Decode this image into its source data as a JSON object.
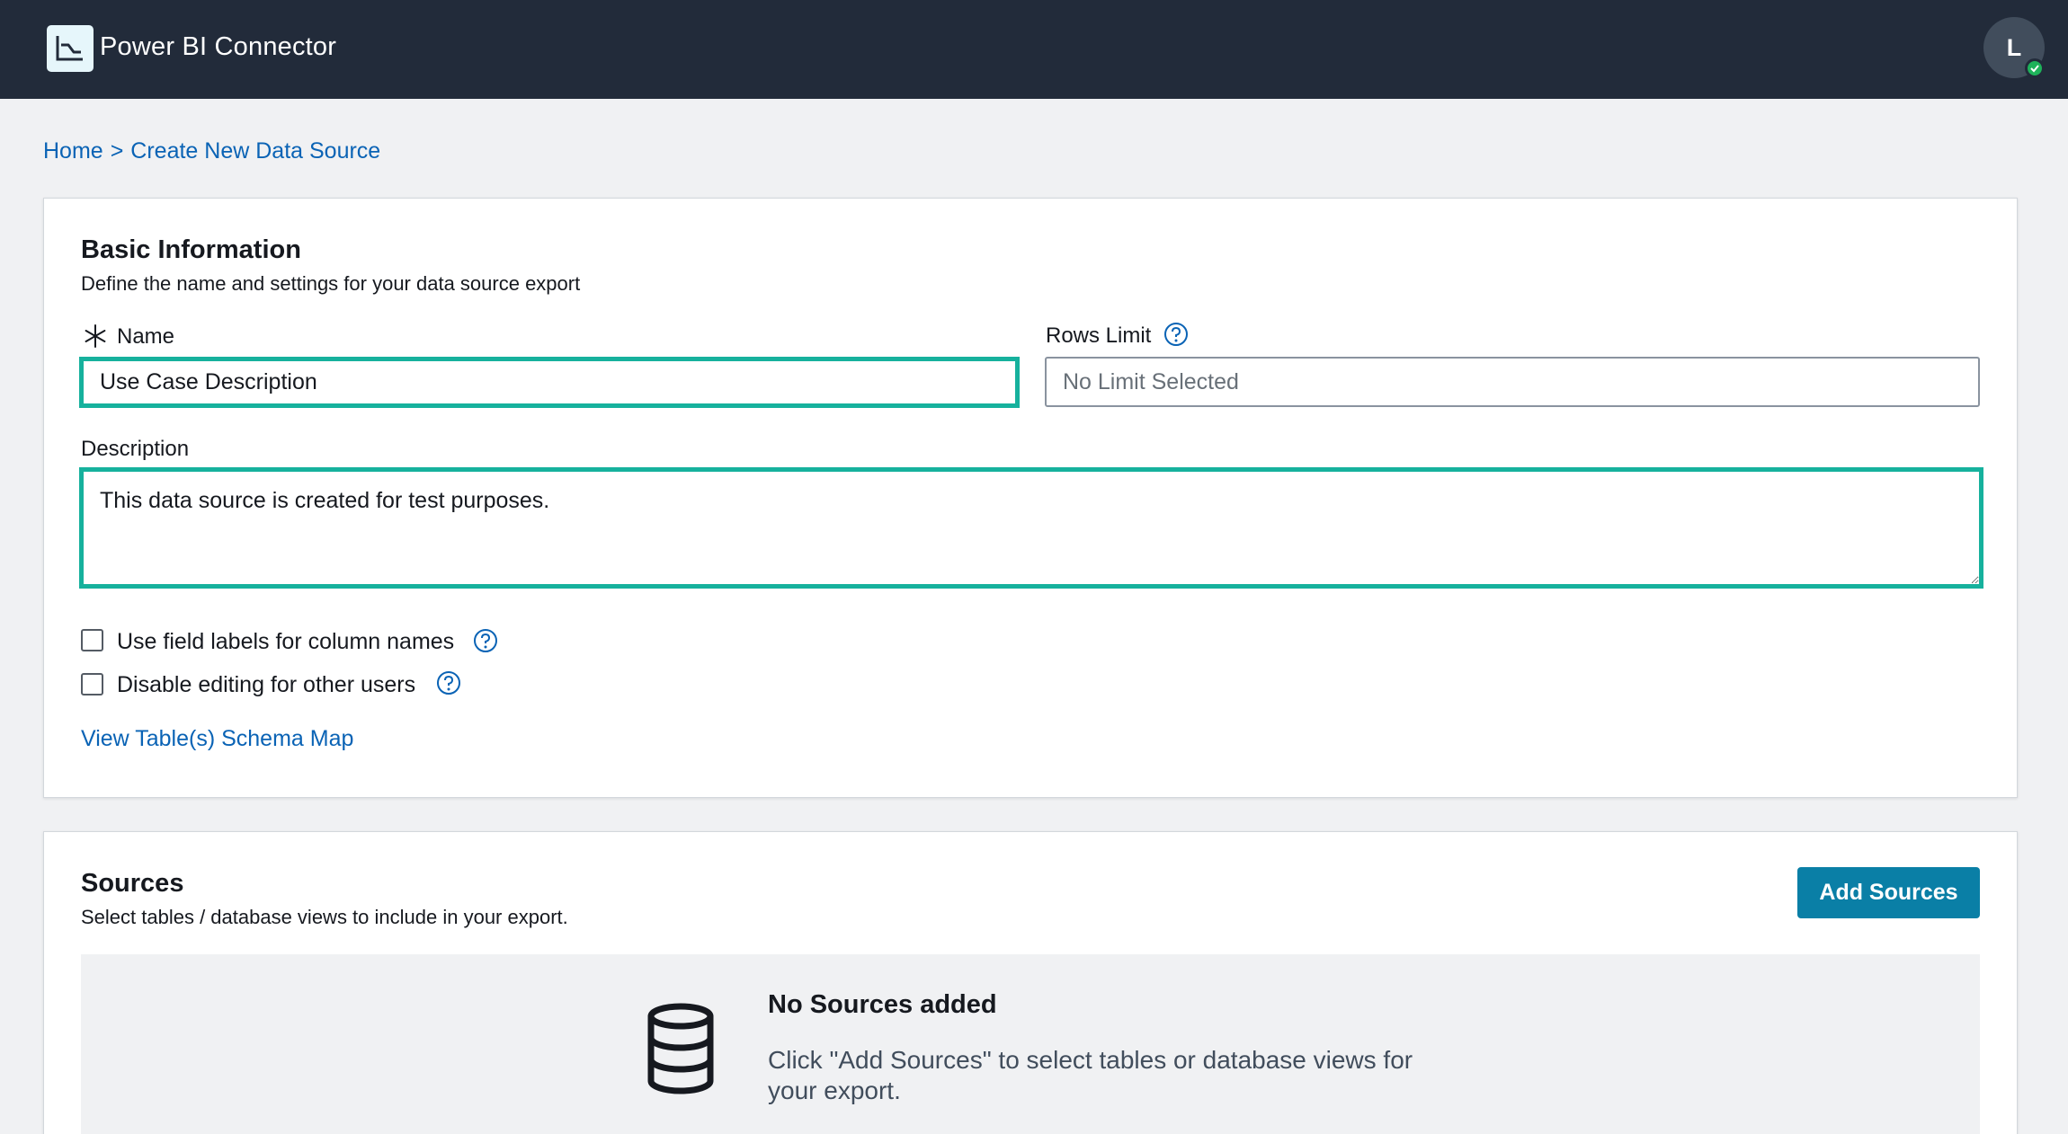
{
  "header": {
    "app_title": "Power BI Connector",
    "logo_icon": "power-bi-connector-logo-icon",
    "avatar_initial": "L",
    "avatar_status": "online",
    "colors": {
      "bar": "#222b3a",
      "status": "#1eb25a"
    }
  },
  "breadcrumb": {
    "home": "Home",
    "separator": ">",
    "current": "Create New Data Source"
  },
  "basic_info": {
    "title": "Basic Information",
    "subtitle": "Define the name and settings for your data source export",
    "name_label": "Name",
    "name_value": "Use Case Description",
    "rows_limit_label": "Rows Limit",
    "rows_limit_placeholder": "No Limit Selected",
    "description_label": "Description",
    "description_value": "This data source is created for test purposes.",
    "checkbox_field_labels": "Use field labels for column names",
    "checkbox_field_labels_checked": false,
    "checkbox_disable_editing": "Disable editing for other users",
    "checkbox_disable_editing_checked": false,
    "schema_map_link": "View Table(s) Schema Map"
  },
  "sources": {
    "title": "Sources",
    "subtitle": "Select tables / database views to include in your export.",
    "add_button": "Add Sources",
    "empty_icon": "database-icon",
    "empty_title": "No Sources added",
    "empty_text": "Click \"Add Sources\" to select tables or database views for your export."
  },
  "colors": {
    "focus_border": "#16b19d",
    "link": "#0a63b5",
    "primary_button": "#0a7fa6",
    "page_background": "#f0f1f3"
  }
}
